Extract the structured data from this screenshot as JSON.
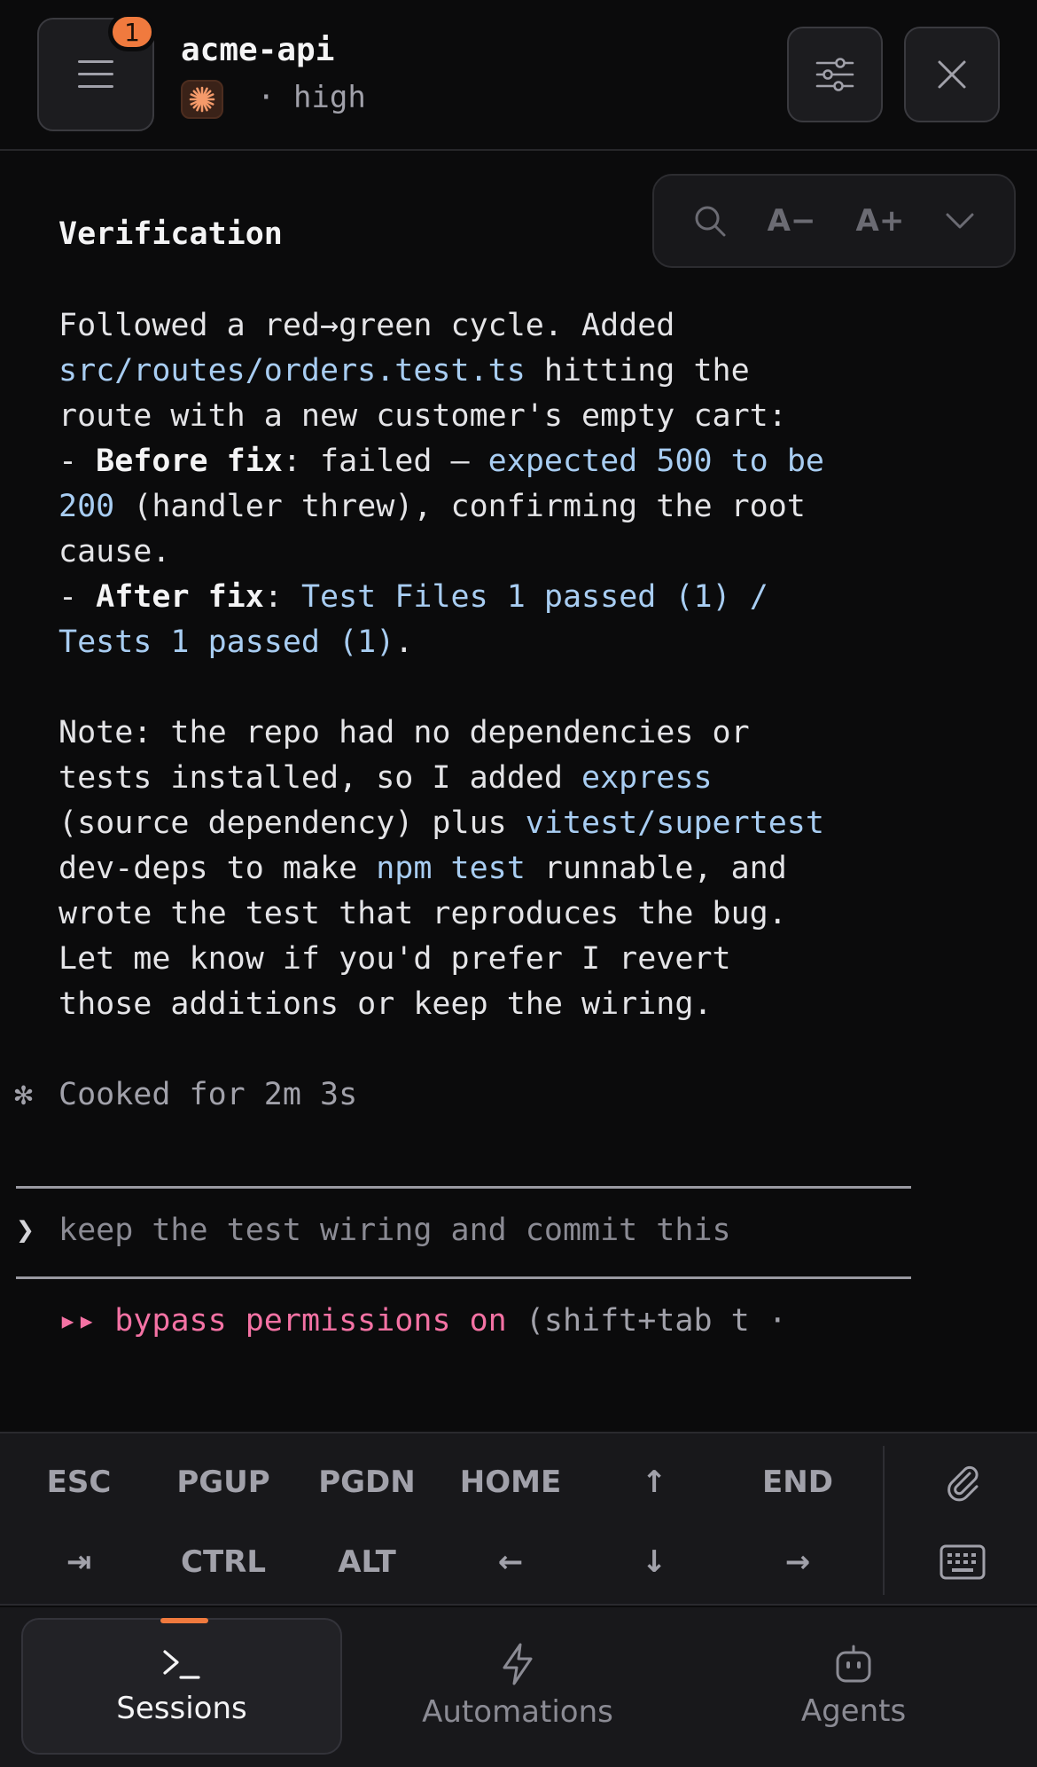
{
  "header": {
    "notification_count": "1",
    "title": "acme-api",
    "effort": "· high"
  },
  "float_toolbar": {
    "font_decrease": "A−",
    "font_increase": "A+"
  },
  "content": {
    "heading": "Verification",
    "p1_l1": "Followed a red→green cycle. Added",
    "p1_l2_code": "src/routes/orders.test.ts",
    "p1_l2_rest": " hitting the",
    "p1_l3": "route with a new customer's empty cart:",
    "b1_dash": "- ",
    "b1_label": "Before fix",
    "b1_mid": ": failed — ",
    "b1_code1": "expected 500 to be",
    "b1_code2": "200",
    "b1_rest": " (handler threw), confirming the root",
    "b1_l3": "cause.",
    "b2_dash": "- ",
    "b2_label": "After fix",
    "b2_mid": ": ",
    "b2_code1": "Test Files 1 passed (1) /",
    "b2_code2": "Tests 1 passed (1)",
    "b2_end": ".",
    "n_l1": "Note: the repo had no dependencies or",
    "n_l2_a": "tests installed, so I added ",
    "n_l2_code": "express",
    "n_l3_a": "(source dependency) plus ",
    "n_l3_code": "vitest/supertest",
    "n_l4_a": "dev-deps to make ",
    "n_l4_code": "npm test",
    "n_l4_b": " runnable, and",
    "n_l5": "wrote the test that reproduces the bug.",
    "n_l6": "Let me know if you'd prefer I revert",
    "n_l7": "those additions or keep the wiring.",
    "status_glyph": "✻",
    "status_text": "Cooked for 2m 3s"
  },
  "prompt": {
    "caret": "❯",
    "text": "keep the test wiring and commit this"
  },
  "mode": {
    "arrows": "▸▸",
    "label": "bypass permissions on",
    "hint": " (shift+tab t ·"
  },
  "keys": {
    "esc": "ESC",
    "pgup": "PGUP",
    "pgdn": "PGDN",
    "home": "HOME",
    "up": "↑",
    "end": "END",
    "tab": "⇥",
    "ctrl": "CTRL",
    "alt": "ALT",
    "left": "←",
    "down": "↓",
    "right": "→"
  },
  "nav": {
    "sessions": "Sessions",
    "automations": "Automations",
    "agents": "Agents"
  },
  "colors": {
    "accent": "#f07a3e",
    "code": "#a8cdf2",
    "mode": "#f472a4",
    "background": "#0b0b0c"
  }
}
